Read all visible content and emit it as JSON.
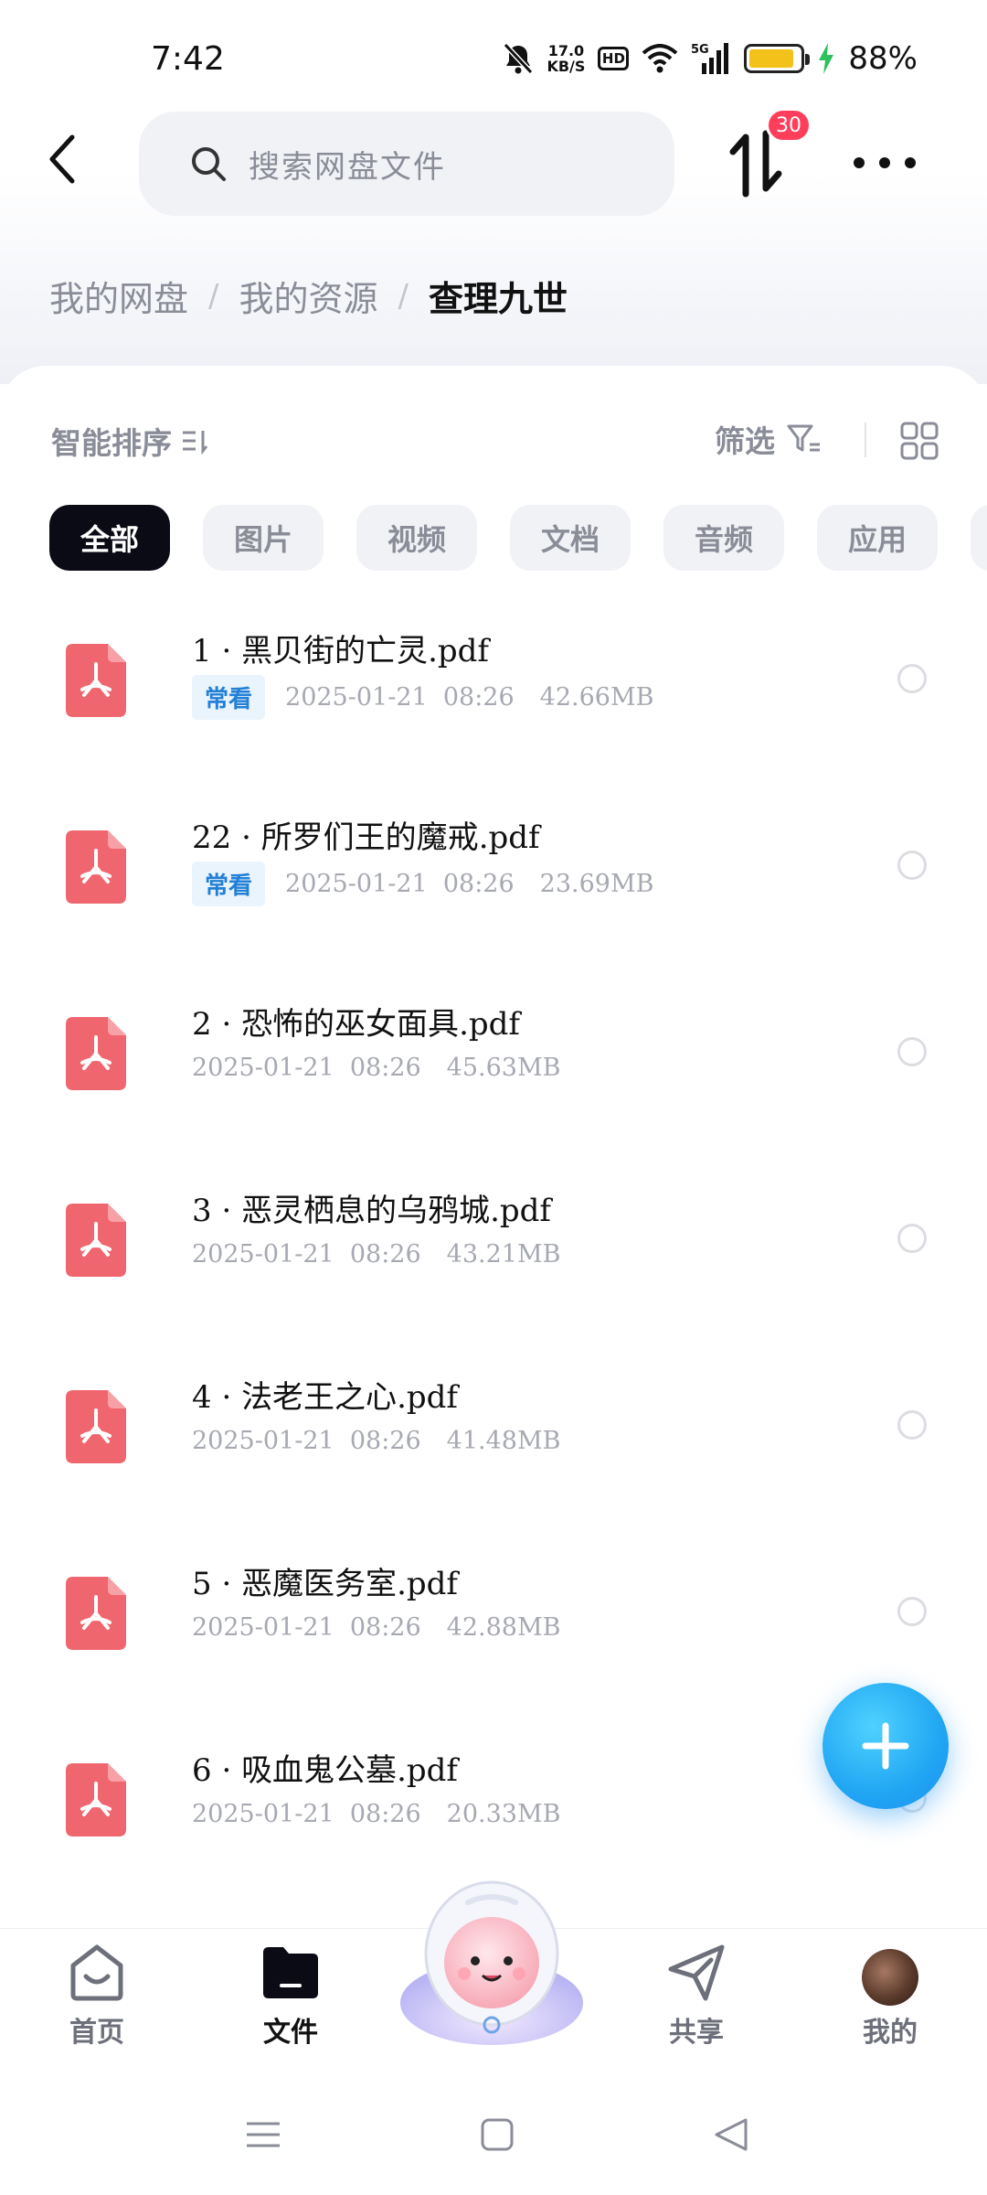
{
  "status_bar": {
    "time": "7:42",
    "net_speed_value": "17.0",
    "net_speed_unit": "KB/S",
    "hd": "HD",
    "network": "5G",
    "battery_percent": "88%",
    "battery_level": 0.88,
    "icons": [
      "mute-bell-icon",
      "wifi-icon",
      "signal-icon",
      "battery-icon",
      "charging-icon"
    ]
  },
  "header": {
    "search_placeholder": "搜索网盘文件",
    "transfer_badge": "30"
  },
  "breadcrumb": {
    "items": [
      "我的网盘",
      "我的资源"
    ],
    "current": "查理九世",
    "separator": "/"
  },
  "toolbar": {
    "sort_label": "智能排序",
    "filter_label": "筛选"
  },
  "tabs": [
    {
      "label": "全部",
      "active": true
    },
    {
      "label": "图片",
      "active": false
    },
    {
      "label": "视频",
      "active": false
    },
    {
      "label": "文档",
      "active": false
    },
    {
      "label": "音频",
      "active": false
    },
    {
      "label": "应用",
      "active": false
    }
  ],
  "files": [
    {
      "prefix": "1 · ",
      "title": "黑贝街的亡灵",
      "ext": ".pdf",
      "tag": "常看",
      "date": "2025-01-21  08:26",
      "size": "42.66MB"
    },
    {
      "prefix": "22 · ",
      "title": "所罗们王的魔戒",
      "ext": ".pdf",
      "tag": "常看",
      "date": "2025-01-21  08:26",
      "size": "23.69MB"
    },
    {
      "prefix": "2 · ",
      "title": "恐怖的巫女面具",
      "ext": ".pdf",
      "tag": "",
      "date": "2025-01-21  08:26",
      "size": "45.63MB"
    },
    {
      "prefix": "3 · ",
      "title": "恶灵栖息的乌鸦城",
      "ext": ".pdf",
      "tag": "",
      "date": "2025-01-21  08:26",
      "size": "43.21MB"
    },
    {
      "prefix": "4 · ",
      "title": "法老王之心",
      "ext": ".pdf",
      "tag": "",
      "date": "2025-01-21  08:26",
      "size": "41.48MB"
    },
    {
      "prefix": "5 · ",
      "title": "恶魔医务室",
      "ext": ".pdf",
      "tag": "",
      "date": "2025-01-21  08:26",
      "size": "42.88MB"
    },
    {
      "prefix": "6 · ",
      "title": "吸血鬼公墓",
      "ext": ".pdf",
      "tag": "",
      "date": "2025-01-21  08:26",
      "size": "20.33MB"
    }
  ],
  "bottom_nav": {
    "home": "首页",
    "files": "文件",
    "share": "共享",
    "mine": "我的"
  },
  "colors": {
    "accent": "#21a6f3",
    "active_tab": "#0a0b14",
    "pdf_icon": "#f0666f",
    "badge": "#ff3e5c",
    "tag_text": "#2380d6"
  }
}
